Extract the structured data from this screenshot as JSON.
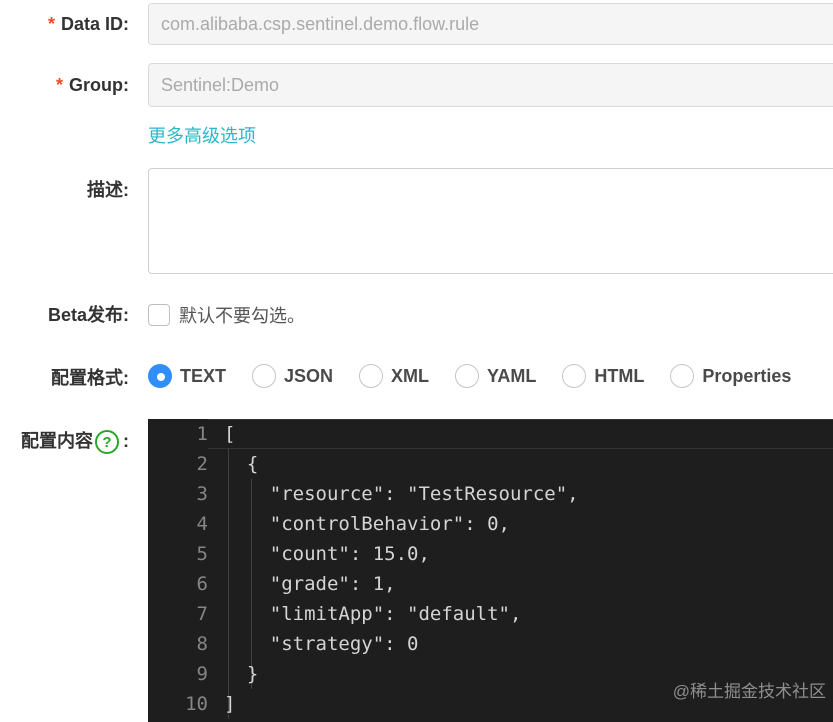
{
  "form": {
    "data_id": {
      "label": "Data ID:",
      "required_mark": "*",
      "value": "com.alibaba.csp.sentinel.demo.flow.rule"
    },
    "group": {
      "label": "Group:",
      "required_mark": "*",
      "value": "Sentinel:Demo"
    },
    "advanced_link": "更多高级选项",
    "description": {
      "label": "描述:",
      "value": ""
    },
    "beta": {
      "label": "Beta发布:",
      "checkbox_text": "默认不要勾选。",
      "checked": false
    },
    "format": {
      "label": "配置格式:",
      "selected": "TEXT",
      "options": [
        "TEXT",
        "JSON",
        "XML",
        "YAML",
        "HTML",
        "Properties"
      ]
    },
    "content": {
      "label": "配置内容",
      "colon": ":",
      "help_icon": "?"
    }
  },
  "editor": {
    "line_numbers": [
      "1",
      "2",
      "3",
      "4",
      "5",
      "6",
      "7",
      "8",
      "9",
      "10"
    ],
    "lines": [
      "[",
      "  {",
      "    \"resource\": \"TestResource\",",
      "    \"controlBehavior\": 0,",
      "    \"count\": 15.0,",
      "    \"grade\": 1,",
      "    \"limitApp\": \"default\",",
      "    \"strategy\": 0",
      "  }",
      "]"
    ]
  },
  "watermark": "@稀土掘金技术社区"
}
